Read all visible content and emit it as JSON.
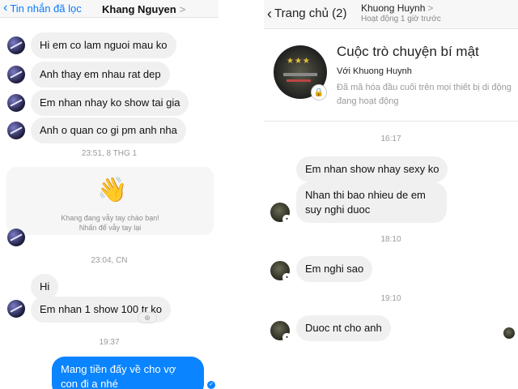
{
  "left": {
    "back_label": "Tin nhắn đã lọc",
    "chev": "‹",
    "title": "Khang Nguyen",
    "title_arrow": ">",
    "messages": [
      "Hi em co lam nguoi mau ko",
      "Anh thay em nhau rat dep",
      "Em nhan nhay ko show tai gia",
      "Anh o quan co gi pm anh nha"
    ],
    "ts1": "23:51, 8 THG 1",
    "wave_icon": "👋",
    "wave_line1": "Khang đang vẫy tay chào bạn!",
    "wave_line2": "Nhấn để vẫy tay lại",
    "ts2": "23:04, CN",
    "msg_hi": "Hi",
    "msg_show": "Em nhan 1 show 100 tr ko",
    "react_icon": "⊕",
    "ts3": "19:37",
    "mine_msg": "Mang tiền đấy về cho vợ con đi a nhé",
    "read_icon": "✓"
  },
  "right": {
    "back_label": "Trang chủ (2)",
    "chev": "‹",
    "name": "Khuong Huynh",
    "name_arrow": ">",
    "status": "Hoạt động 1 giờ trước",
    "secret_title": "Cuộc trò chuyện bí mật",
    "secret_with": "Với Khuong Huynh",
    "secret_desc": "Đã mã hóa đầu cuối trên mọi thiết bị di động đang hoạt động",
    "sec_stars": "★★★",
    "lock_icon": "🔒",
    "ts1": "16:17",
    "m1": "Em nhan show nhay sexy ko",
    "m2": "Nhan thi bao nhieu de em suy nghi duoc",
    "ts2": "18:10",
    "m3": "Em nghi sao",
    "ts3": "19:10",
    "m4": "Duoc nt cho anh"
  }
}
